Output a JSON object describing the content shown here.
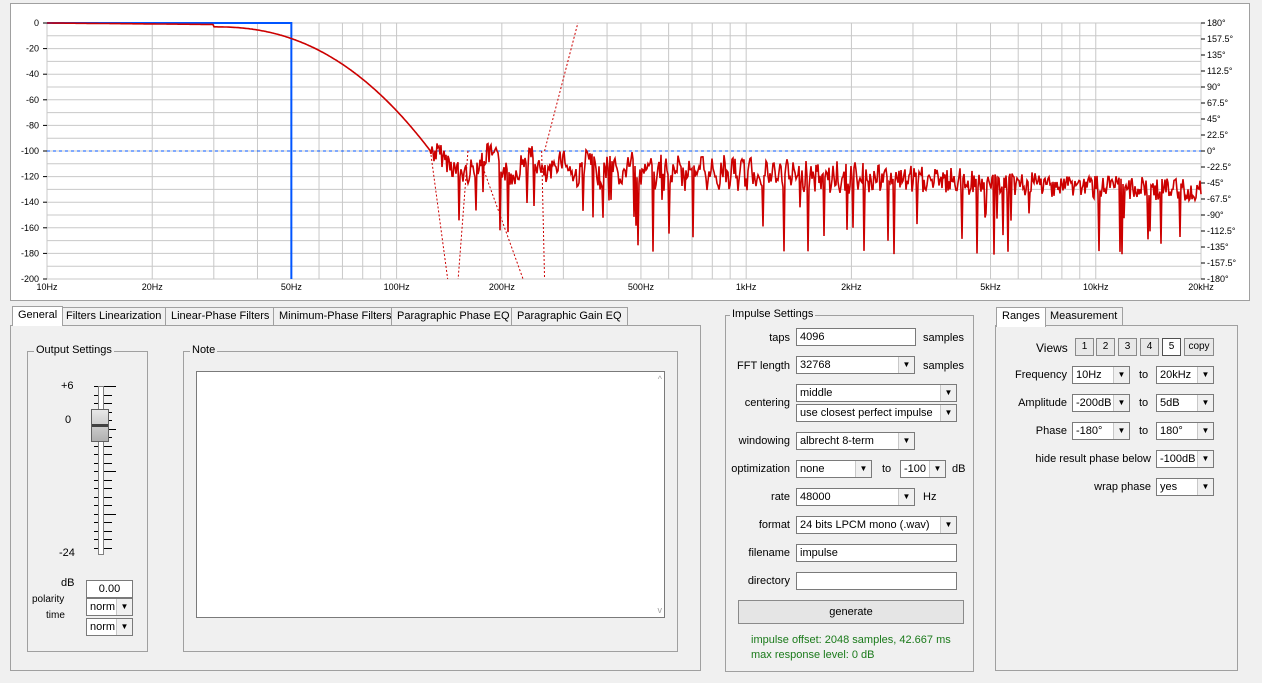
{
  "graph": {
    "x_ticks": [
      "10Hz",
      "20Hz",
      "50Hz",
      "100Hz",
      "200Hz",
      "500Hz",
      "1kHz",
      "2kHz",
      "5kHz",
      "10kHz",
      "20kHz"
    ],
    "y_left_ticks": [
      "0",
      "-20",
      "-40",
      "-60",
      "-80",
      "-100",
      "-120",
      "-140",
      "-160",
      "-180",
      "-200"
    ],
    "y_right_ticks": [
      "180°",
      "157.5°",
      "135°",
      "112.5°",
      "90°",
      "67.5°",
      "45°",
      "22.5°",
      "0°",
      "-22.5°",
      "-45°",
      "-67.5°",
      "-90°",
      "-112.5°",
      "-135°",
      "-157.5°",
      "-180°"
    ],
    "colors": {
      "magnitude": "#cc0000",
      "target": "#0055ff",
      "phase_ref": "#0055ff",
      "grid": "#c8c8c8"
    }
  },
  "tabs": [
    "General",
    "Filters Linearization",
    "Linear-Phase Filters",
    "Minimum-Phase Filters",
    "Paragraphic Phase EQ",
    "Paragraphic Gain EQ"
  ],
  "general": {
    "output_title": "Output Settings",
    "scale_top": "+6",
    "scale_zero": "0",
    "scale_bottom": "-24",
    "db_label": "dB",
    "db_value": "0.00",
    "polarity_label": "polarity",
    "polarity_value": "norm",
    "time_label": "time",
    "time_value": "norm",
    "note_title": "Note"
  },
  "impulse": {
    "title": "Impulse Settings",
    "taps_label": "taps",
    "taps_value": "4096",
    "taps_unit": "samples",
    "fft_label": "FFT length",
    "fft_value": "32768",
    "fft_unit": "samples",
    "centering_label": "centering",
    "centering_value": "middle",
    "centering_mode": "use closest perfect impulse",
    "windowing_label": "windowing",
    "windowing_value": "albrecht 8-term",
    "optimization_label": "optimization",
    "optimization_value": "none",
    "opt_to": "to",
    "opt_to_value": "-100",
    "opt_unit": "dB",
    "rate_label": "rate",
    "rate_value": "48000",
    "rate_unit": "Hz",
    "format_label": "format",
    "format_value": "24 bits LPCM mono (.wav)",
    "filename_label": "filename",
    "filename_value": "impulse",
    "directory_label": "directory",
    "directory_value": "",
    "generate_label": "generate",
    "status_line1": "impulse offset: 2048 samples, 42.667 ms",
    "status_line2": "max response level: 0 dB"
  },
  "ranges": {
    "tabs": [
      "Ranges",
      "Measurement"
    ],
    "views_label": "Views",
    "view_buttons": [
      "1",
      "2",
      "3",
      "4",
      "5"
    ],
    "copy_label": "copy",
    "frequency_label": "Frequency",
    "freq_from": "10Hz",
    "to_label": "to",
    "freq_to": "20kHz",
    "amplitude_label": "Amplitude",
    "amp_from": "-200dB",
    "amp_to": "5dB",
    "phase_label": "Phase",
    "phase_from": "-180°",
    "phase_to": "180°",
    "hide_label": "hide result phase below",
    "hide_value": "-100dB",
    "wrap_label": "wrap phase",
    "wrap_value": "yes"
  }
}
